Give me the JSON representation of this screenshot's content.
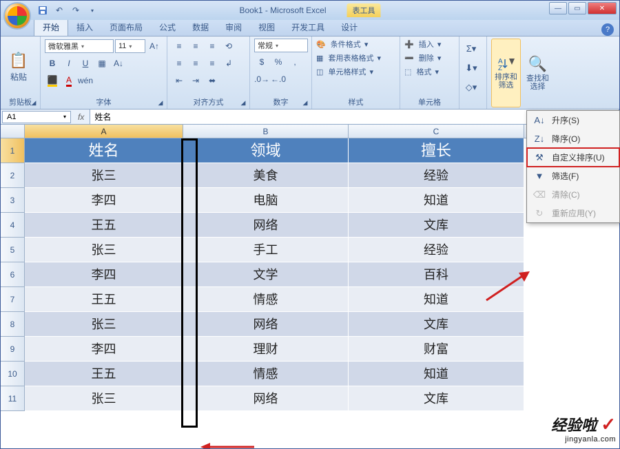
{
  "window": {
    "title": "Book1 - Microsoft Excel",
    "context_tool": "表工具",
    "min": "—",
    "max": "▭",
    "close": "✕"
  },
  "qat": {
    "save": "💾",
    "undo": "↶",
    "redo": "↷",
    "more": "▾"
  },
  "tabs": {
    "items": [
      "开始",
      "插入",
      "页面布局",
      "公式",
      "数据",
      "审阅",
      "视图",
      "开发工具",
      "设计"
    ],
    "active": "开始",
    "help": "?"
  },
  "ribbon": {
    "clipboard": {
      "label": "剪贴板",
      "paste": "粘贴"
    },
    "font": {
      "label": "字体",
      "name": "微软雅黑",
      "size": "11",
      "bold": "B",
      "italic": "I",
      "underline": "U"
    },
    "align": {
      "label": "对齐方式"
    },
    "number": {
      "label": "数字",
      "format": "常规"
    },
    "styles": {
      "label": "样式",
      "cond": "条件格式",
      "table": "套用表格格式",
      "cell": "单元格样式"
    },
    "cells": {
      "label": "单元格",
      "insert": "插入",
      "delete": "删除",
      "format": "格式"
    },
    "editing": {
      "sort": "排序和筛选",
      "find": "查找和选择"
    }
  },
  "formula_bar": {
    "name_box": "A1",
    "fx": "fx",
    "value": "姓名"
  },
  "columns": [
    "A",
    "B",
    "C"
  ],
  "row_numbers": [
    "1",
    "2",
    "3",
    "4",
    "5",
    "6",
    "7",
    "8",
    "9",
    "10",
    "11"
  ],
  "headers": [
    "姓名",
    "领域",
    "擅长"
  ],
  "data_rows": [
    [
      "张三",
      "美食",
      "经验"
    ],
    [
      "李四",
      "电脑",
      "知道"
    ],
    [
      "王五",
      "网络",
      "文库"
    ],
    [
      "张三",
      "手工",
      "经验"
    ],
    [
      "李四",
      "文学",
      "百科"
    ],
    [
      "王五",
      "情感",
      "知道"
    ],
    [
      "张三",
      "网络",
      "文库"
    ],
    [
      "李四",
      "理财",
      "财富"
    ],
    [
      "王五",
      "情感",
      "知道"
    ],
    [
      "张三",
      "网络",
      "文库"
    ]
  ],
  "dropdown": {
    "asc": "升序(S)",
    "desc": "降序(O)",
    "custom": "自定义排序(U)",
    "filter": "筛选(F)",
    "clear": "清除(C)",
    "reapply": "重新应用(Y)"
  },
  "watermark": {
    "line1": "经验啦",
    "check": "✓",
    "line2": "jingyanla.com"
  }
}
